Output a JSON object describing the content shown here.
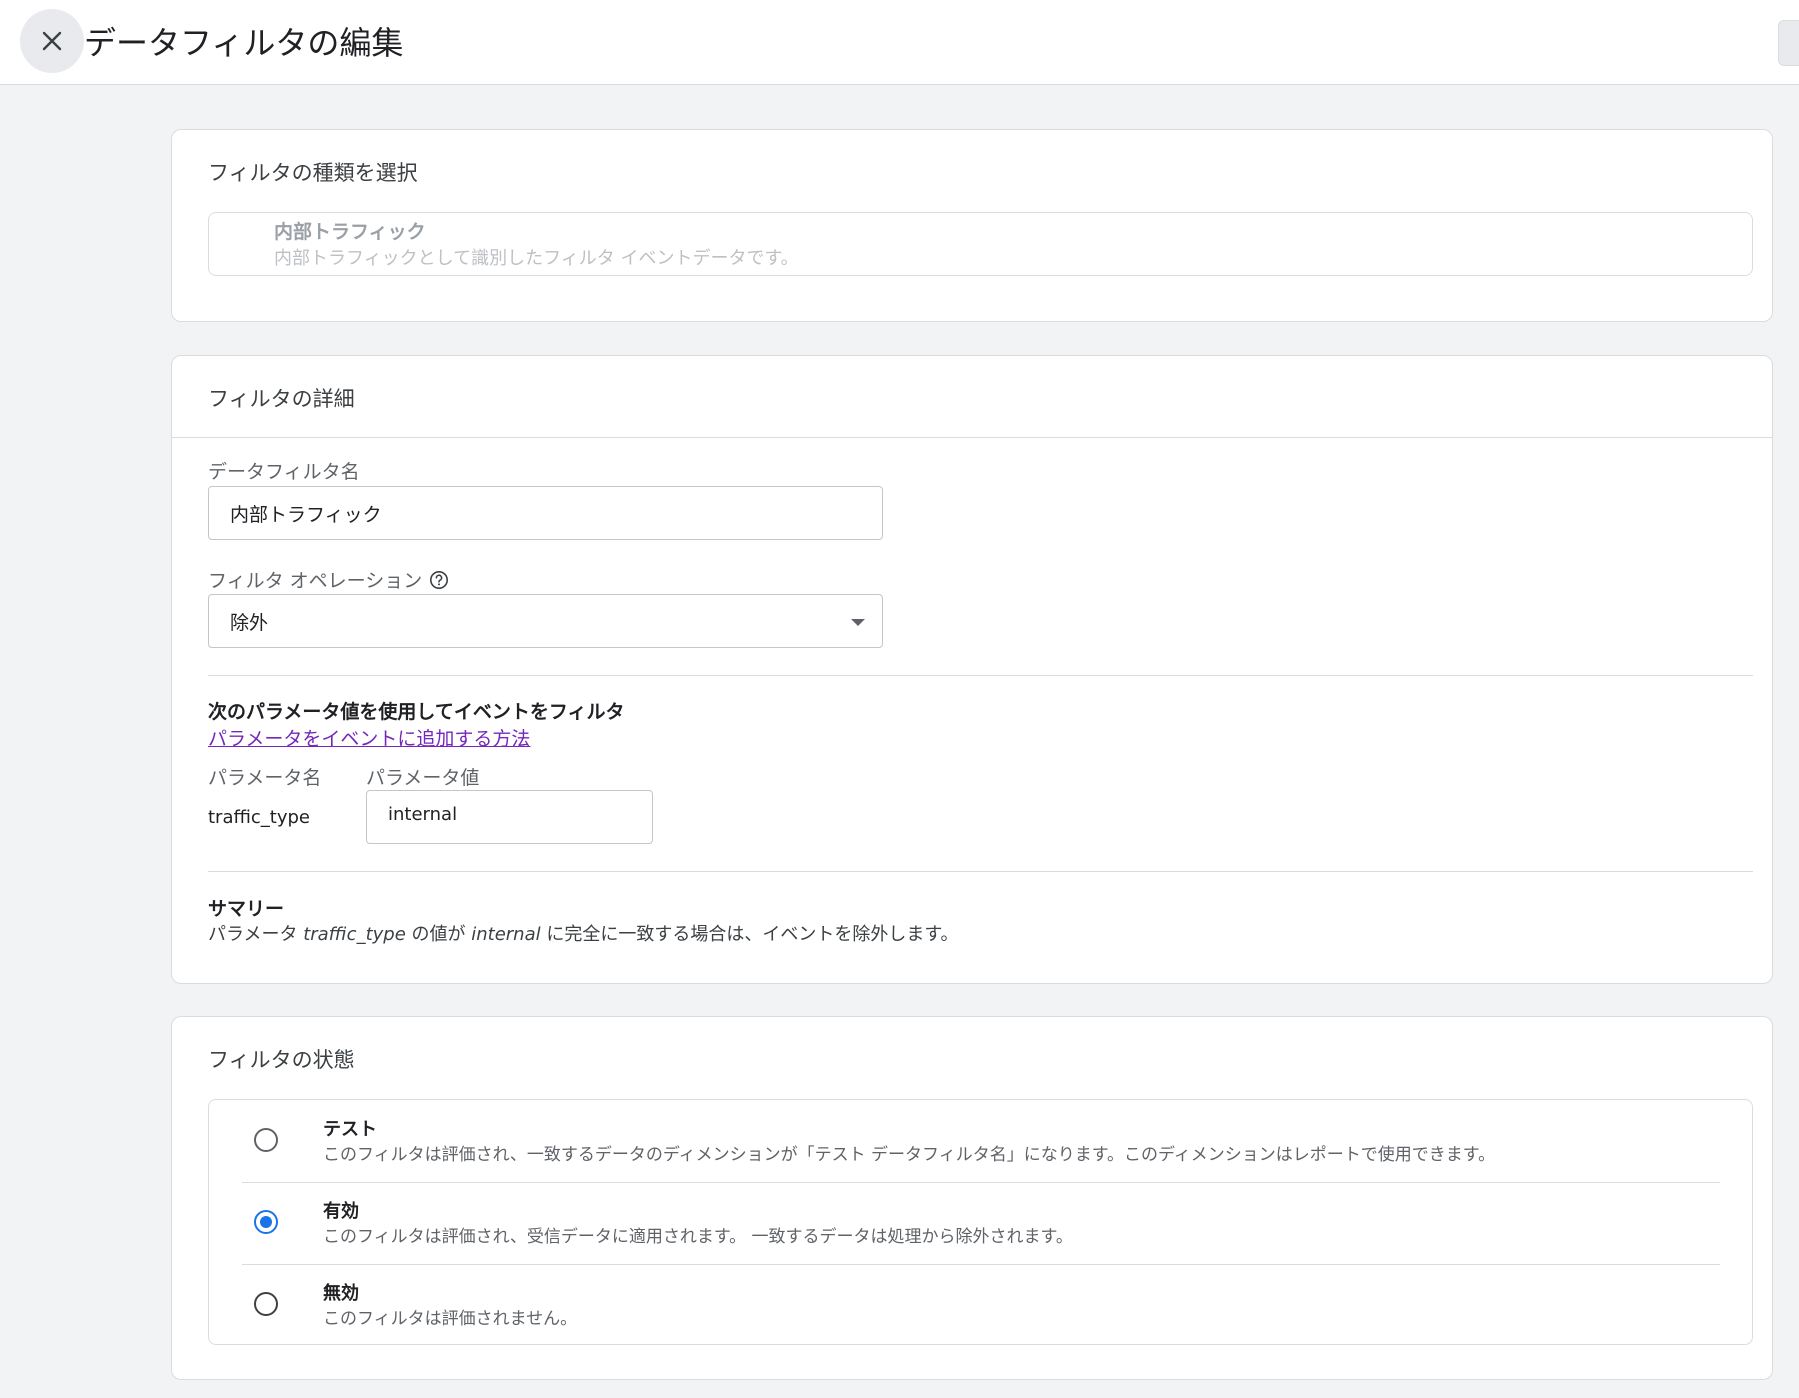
{
  "header": {
    "title": "データフィルタの編集",
    "close_icon": "close-icon"
  },
  "filter_type": {
    "section_title": "フィルタの種類を選択",
    "option_title": "内部トラフィック",
    "option_desc": "内部トラフィックとして識別したフィルタ イベントデータです。"
  },
  "details": {
    "section_title": "フィルタの詳細",
    "name_label": "データフィルタ名",
    "name_value": "内部トラフィック",
    "operation_label": "フィルタ オペレーション",
    "help_icon": "help-icon",
    "operation_value": "除外",
    "param_heading": "次のパラメータ値を使用してイベントをフィルタ",
    "param_link": "パラメータをイベントに追加する方法",
    "param_name_header": "パラメータ名",
    "param_value_header": "パラメータ値",
    "param_name": "traffic_type",
    "param_value": "internal",
    "summary_heading": "サマリー",
    "summary": {
      "prefix": "パラメータ ",
      "param": "traffic_type",
      "middle": " の値が ",
      "value": "internal",
      "suffix": " に完全に一致する場合は、イベントを除外します。"
    }
  },
  "state": {
    "section_title": "フィルタの状態",
    "selected": "有効",
    "accent_color": "#1a73e8",
    "options": [
      {
        "label": "テスト",
        "desc": "このフィルタは評価され、一致するデータのディメンションが「テスト データフィルタ名」になります。このディメンションはレポートで使用できます。"
      },
      {
        "label": "有効",
        "desc": "このフィルタは評価され、受信データに適用されます。 一致するデータは処理から除外されます。"
      },
      {
        "label": "無効",
        "desc": "このフィルタは評価されません。"
      }
    ]
  }
}
